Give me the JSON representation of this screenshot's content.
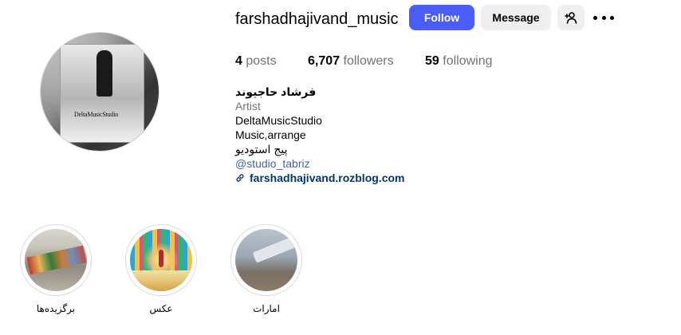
{
  "profile": {
    "username": "farshadhajivand_music",
    "follow_label": "Follow",
    "message_label": "Message",
    "add_user_icon": "person-plus-icon",
    "more_icon": "more-horizontal-icon",
    "avatar_caption": "DeltaMusicStudio"
  },
  "stats": {
    "posts_count": "4",
    "posts_label": "posts",
    "followers_count": "6,707",
    "followers_label": "followers",
    "following_count": "59",
    "following_label": "following"
  },
  "bio": {
    "name": "فرشاد حاجیوند",
    "category": "Artist",
    "lines": [
      "DeltaMusicStudio",
      "Music,arrange",
      "پیج استودیو"
    ],
    "mention": "@studio_tabriz",
    "link_icon": "link-icon",
    "link": "farshadhajivand.rozblog.com"
  },
  "highlights": [
    {
      "label": "برگزیده‌ها"
    },
    {
      "label": "عکس"
    },
    {
      "label": "امارات"
    }
  ],
  "colors": {
    "follow_button": "#4a5df9",
    "secondary_button": "#efefef",
    "muted_text": "#737373",
    "mention": "#4062b5",
    "link": "#00376b"
  }
}
